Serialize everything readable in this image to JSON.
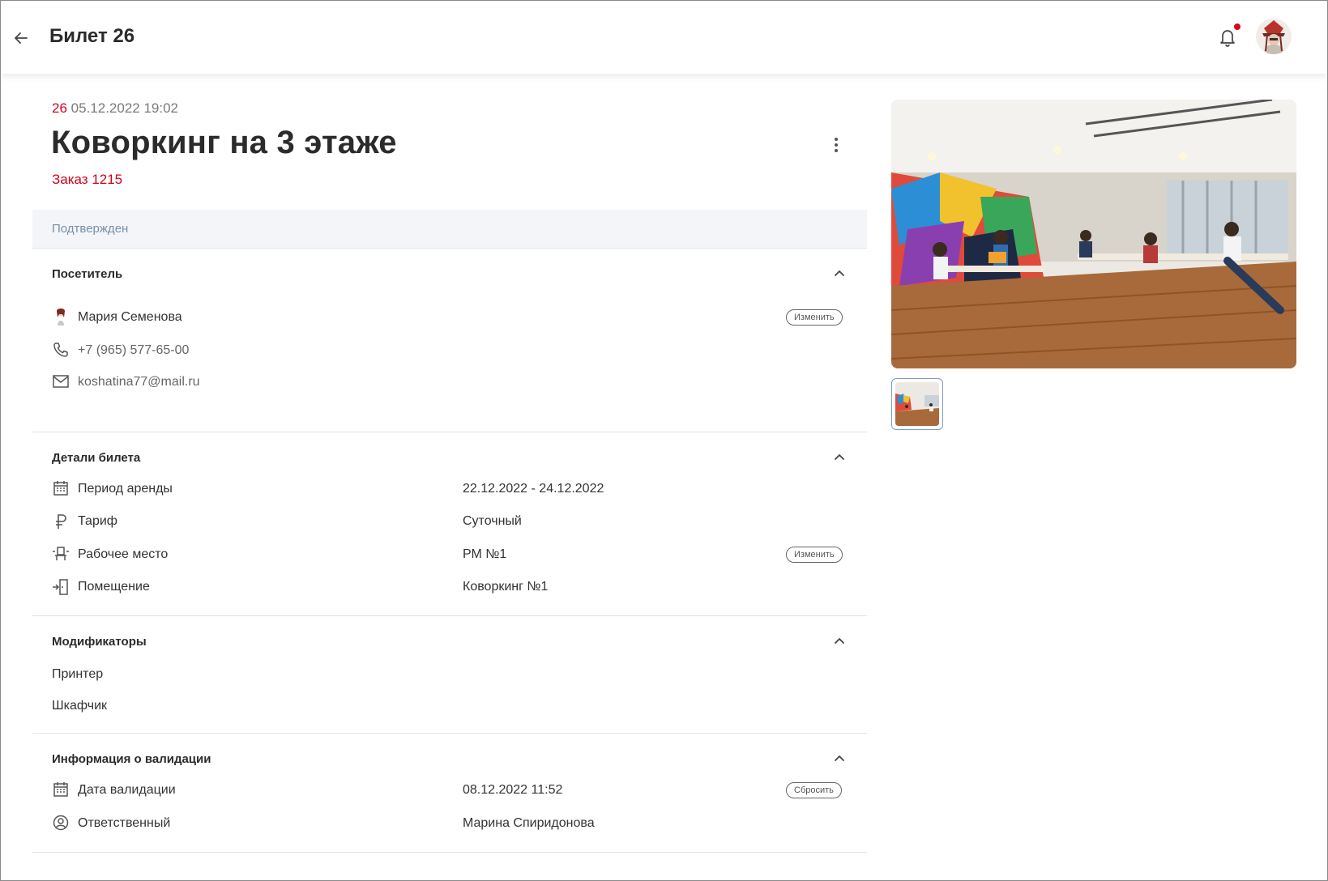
{
  "header": {
    "title": "Билет 26",
    "back_icon": "arrow-left-icon",
    "bell_icon": "bell-icon",
    "notification_color": "#e0001b"
  },
  "ticket": {
    "number": "26",
    "datetime": "05.12.2022 19:02",
    "title": "Коворкинг на 3 этаже",
    "order": "Заказ 1215",
    "status": "Подтвержден",
    "accent_color": "#d0021b"
  },
  "visitor": {
    "title": "Посетитель",
    "name": "Мария Семенова",
    "phone": "+7 (965) 577-65-00",
    "email": "koshatina77@mail.ru",
    "change_label": "Изменить"
  },
  "details": {
    "title": "Детали билета",
    "rows": [
      {
        "icon": "calendar-icon",
        "label": "Период аренды",
        "value": "22.12.2022 - 24.12.2022"
      },
      {
        "icon": "ruble-icon",
        "label": "Тариф",
        "value": "Суточный"
      },
      {
        "icon": "workplace-icon",
        "label": "Рабочее место",
        "value": "РМ №1"
      },
      {
        "icon": "door-enter-icon",
        "label": "Помещение",
        "value": "Коворкинг №1"
      }
    ],
    "change_label": "Изменить"
  },
  "modifiers": {
    "title": "Модификаторы",
    "items": [
      "Принтер",
      "Шкафчик"
    ]
  },
  "validation": {
    "title": "Информация о валидации",
    "rows": [
      {
        "icon": "calendar-icon",
        "label": "Дата валидации",
        "value": "08.12.2022 11:52"
      },
      {
        "icon": "user-circle-icon",
        "label": "Ответственный",
        "value": "Марина Спиридонова"
      }
    ],
    "reset_label": "Сбросить"
  }
}
